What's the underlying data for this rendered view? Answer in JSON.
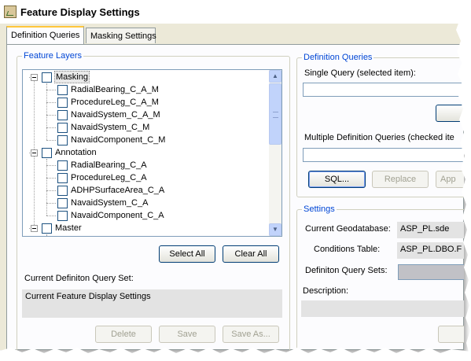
{
  "window": {
    "title": "Feature Display Settings",
    "icon": "feature-display-app-icon"
  },
  "tabs": [
    {
      "label": "Definition Queries",
      "active": true
    },
    {
      "label": "Masking Settings",
      "active": false
    }
  ],
  "feature_layers": {
    "group_label": "Feature Layers",
    "tree": [
      {
        "label": "Masking",
        "level": 0,
        "expanded": true,
        "checked": false,
        "selected": true
      },
      {
        "label": "RadialBearing_C_A_M",
        "level": 1,
        "checked": false
      },
      {
        "label": "ProcedureLeg_C_A_M",
        "level": 1,
        "checked": false
      },
      {
        "label": "NavaidSystem_C_A_M",
        "level": 1,
        "checked": false
      },
      {
        "label": "NavaidSystem_C_M",
        "level": 1,
        "checked": false
      },
      {
        "label": "NavaidComponent_C_M",
        "level": 1,
        "checked": false
      },
      {
        "label": "Annotation",
        "level": 0,
        "expanded": true,
        "checked": false
      },
      {
        "label": "RadialBearing_C_A",
        "level": 1,
        "checked": false
      },
      {
        "label": "ProcedureLeg_C_A",
        "level": 1,
        "checked": false
      },
      {
        "label": "ADHPSurfaceArea_C_A",
        "level": 1,
        "checked": false
      },
      {
        "label": "NavaidSystem_C_A",
        "level": 1,
        "checked": false
      },
      {
        "label": "NavaidComponent_C_A",
        "level": 1,
        "checked": false
      },
      {
        "label": "Master",
        "level": 0,
        "expanded": true,
        "checked": false
      }
    ],
    "select_all_label": "Select All",
    "clear_all_label": "Clear All",
    "current_set_label": "Current Definiton Query Set:",
    "current_set_value": "Current Feature Display Settings",
    "delete_label": "Delete",
    "save_label": "Save",
    "save_as_label": "Save As..."
  },
  "definition_queries": {
    "group_label": "Definition Queries",
    "single_query_label": "Single Query (selected item):",
    "single_query_value": "",
    "multiple_query_label": "Multiple Definition Queries (checked ite",
    "multiple_query_value": "",
    "sql_label": "SQL...",
    "replace_label": "Replace",
    "append_label": "App"
  },
  "settings": {
    "group_label": "Settings",
    "current_gdb_label": "Current Geodatabase:",
    "current_gdb_value": "ASP_PL.sde",
    "conditions_table_label": "Conditions Table:",
    "conditions_table_value": "ASP_PL.DBO.F",
    "query_sets_label": "Definiton Query Sets:",
    "description_label": "Description:",
    "description_value": ""
  },
  "colors": {
    "dialog_bg": "#ece9d8",
    "panel_bg": "#fcfcfe",
    "group_label": "#0046d5",
    "button_border": "#003c74",
    "active_tab_accent": "#ffc73c"
  }
}
